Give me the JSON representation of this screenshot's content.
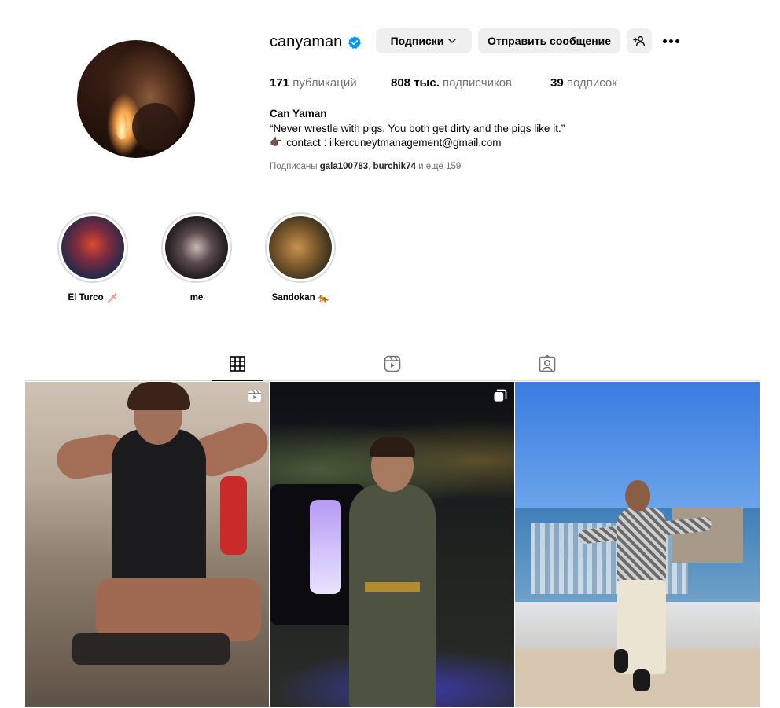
{
  "profile": {
    "username": "canyaman",
    "verified": true,
    "buttons": {
      "following": "Подписки",
      "message": "Отправить сообщение"
    },
    "stats": {
      "posts_value": "171",
      "posts_label": "публикаций",
      "followers_value": "808 тыс.",
      "followers_label": "подписчиков",
      "following_value": "39",
      "following_label": "подписок"
    },
    "full_name": "Can Yaman",
    "bio_quote": "“Never wrestle with pigs. You both get dirty and the pigs like it.”",
    "bio_contact_emoji": "👉🏿",
    "bio_contact": "contact : ilkercuneytmanagement@gmail.com",
    "followed_by": {
      "prefix": "Подписаны",
      "user1": "gala100783",
      "separator": ",",
      "user2": "burchik74",
      "suffix": "и ещё 159"
    }
  },
  "highlights": [
    {
      "label": "El Turco",
      "emoji": "🗡"
    },
    {
      "label": "me",
      "emoji": ""
    },
    {
      "label": "Sandokan",
      "emoji": "🐅"
    }
  ],
  "tabs": [
    {
      "name": "posts",
      "icon": "grid-icon",
      "active": true
    },
    {
      "name": "reels",
      "icon": "reels-icon",
      "active": false
    },
    {
      "name": "tagged",
      "icon": "tagged-icon",
      "active": false
    }
  ],
  "posts": [
    {
      "type": "reel",
      "icon": "reels-icon"
    },
    {
      "type": "carousel",
      "icon": "carousel-icon"
    },
    {
      "type": "photo",
      "icon": ""
    }
  ],
  "colors": {
    "verified_badge": "#0095f6",
    "button_bg": "#efefef",
    "muted_text": "#737373",
    "border": "#dbdbdb"
  }
}
